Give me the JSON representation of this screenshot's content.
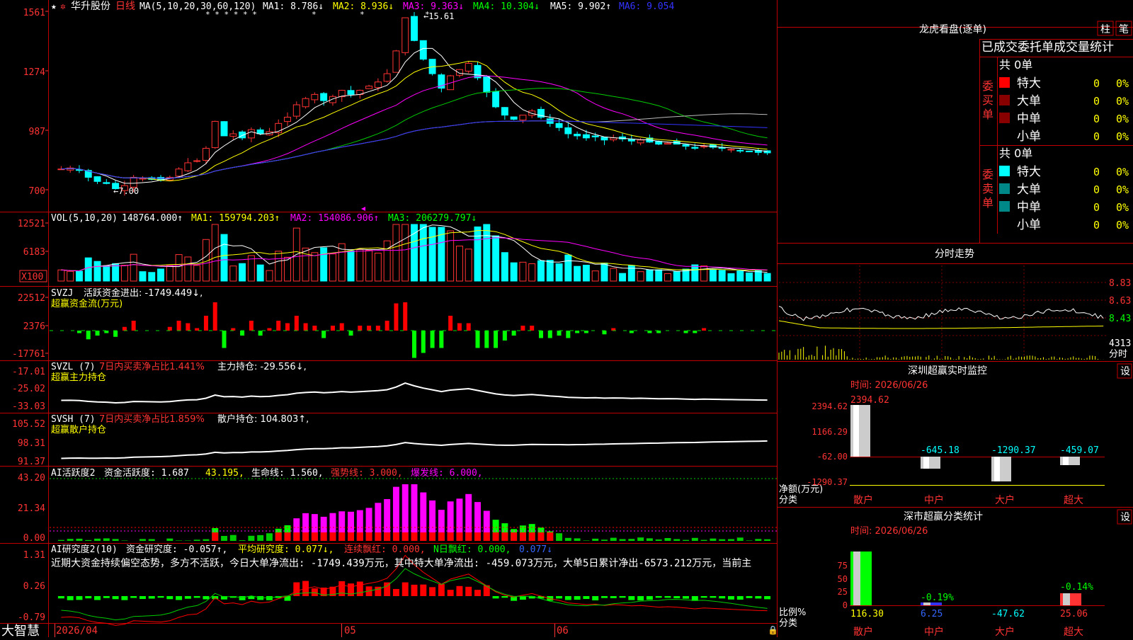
{
  "stock": {
    "name": "华升股份",
    "period": "日线",
    "brand": "大智慧",
    "high_label": "←15.61",
    "low_label": "←7.00",
    "yaxis": [
      "1561",
      "1274",
      "987",
      "700"
    ],
    "ma_label": "MA(5,10,20,30,60,120)",
    "ma": [
      "MA1: 8.786↓",
      "MA2: 8.936↓",
      "MA3: 9.363↓",
      "MA4: 10.304↓",
      "MA5: 9.902↑",
      "MA6: 9.054"
    ],
    "dates": [
      "2026/04",
      "05",
      "06"
    ]
  },
  "vol": {
    "label": "VOL(5,10,20)",
    "value": "148764.000↑",
    "ma": [
      "MA1: 159794.203↑",
      "MA2: 154086.906↑",
      "MA3: 206279.797↓"
    ],
    "yaxis": [
      "12521",
      "6183",
      "X100"
    ]
  },
  "svzj": {
    "label": "SVZJ",
    "text": "活跃资金进出: -1749.449↓,",
    "sub": "超赢资金流(万元)",
    "yaxis": [
      "22512",
      "2376",
      "-17761"
    ]
  },
  "svzl": {
    "label": "SVZL (7)",
    "text1": "7日内买卖净占比1.441%",
    "text2": "主力持仓: -29.556↓,",
    "sub": "超赢主力持仓",
    "yaxis": [
      "-17.01",
      "-25.02",
      "-33.03"
    ]
  },
  "svsh": {
    "label": "SVSH (7)",
    "text1": "7日内买卖净占比1.859%",
    "text2": "散户持仓: 104.803↑,",
    "sub": "超赢散户持仓",
    "yaxis": [
      "105.52",
      "98.31",
      "91.37"
    ]
  },
  "ai1": {
    "label": "AI活跃度2",
    "t1": "资金活跃度: 1.687",
    "t2": "43.195,",
    "t3": "生命线: 1.560,",
    "t4": "强势线: 3.000,",
    "t5": "爆发线: 6.000,",
    "yaxis": [
      "43.20",
      "21.34",
      "0.00"
    ]
  },
  "ai2": {
    "label": "AI研究度2(10)",
    "t1": "资金研究度: -0.057↑,",
    "t2": "平均研究度: 0.077↓,",
    "t3": "连续飘红: 0.000,",
    "t4": "N日飘红: 0.000,",
    "t5": "0.077↓",
    "desc": "近期大资金持续偏空态势，多方不活跃，今日大单净流出: -1749.439万元，其中特大单净流出: -459.073万元，大单5日累计净出-6573.212万元，当前主",
    "yaxis": [
      "1.31",
      "0.26",
      "-0.79"
    ]
  },
  "right": {
    "lhb_title": "龙虎看盘(逐单)",
    "btn1": "柱",
    "btn2": "笔",
    "tabs": "已成交委托单成交量统计",
    "buy_group": "委买单",
    "sell_group": "委卖单",
    "buy_total": "共 0单",
    "sell_total": "共 0单",
    "rows": [
      "特大",
      "大单",
      "中单",
      "小单"
    ],
    "row_count": "0",
    "row_pct": "0%",
    "buy_colors": [
      "#ff0000",
      "#880000",
      "#880000",
      "#000000"
    ],
    "sell_colors": [
      "#00ffff",
      "#008888",
      "#008888",
      "#000000"
    ],
    "fs_title": "分时走势",
    "fs_axis": [
      "8.83",
      "8.63",
      "8.43",
      "4313",
      "分时"
    ],
    "sz_title": "深圳超赢实时监控",
    "set": "设",
    "time1": "时间: 2026/06/26",
    "net_axis": [
      "2394.62",
      "1166.29",
      "-62.00",
      "-1290.37"
    ],
    "net_unit": "净额(万元)",
    "cat_label": "分类",
    "cats": [
      "散户",
      "中户",
      "大户",
      "超大"
    ],
    "net_values": [
      "2394.62",
      "-645.18",
      "-1290.37",
      "-459.07"
    ],
    "ss_title": "深市超赢分类统计",
    "time2": "时间: 2026/06/26",
    "ratio_axis": [
      "75",
      "50",
      "25",
      "0"
    ],
    "ratio_unit": "比例%",
    "ratio_top": [
      "",
      "-0.19%",
      "",
      "-0.14%"
    ],
    "ratio_values": [
      "116.30",
      "6.25",
      "-47.62",
      "25.06"
    ]
  }
}
